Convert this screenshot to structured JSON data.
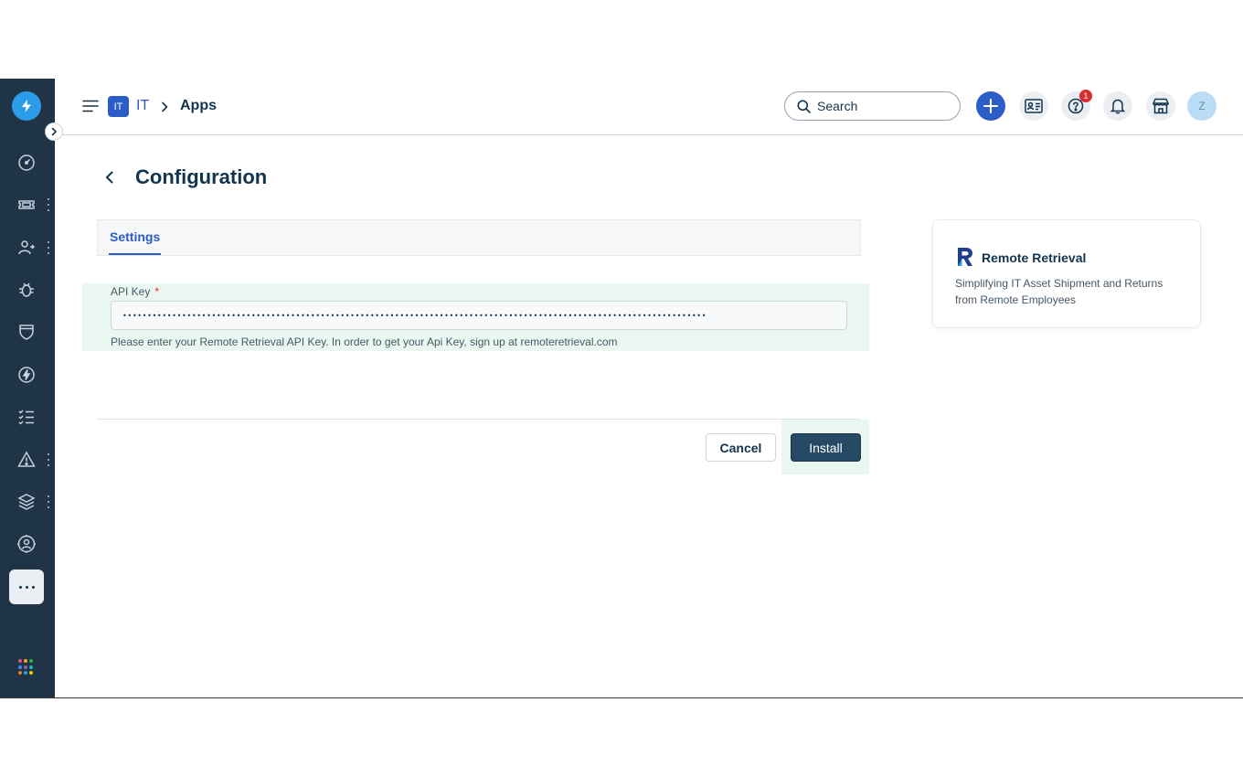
{
  "header": {
    "workspace_badge": "IT",
    "workspace_name": "IT",
    "breadcrumb_current": "Apps",
    "search_placeholder": "Search",
    "notification_count": "1",
    "avatar_initial": "Z"
  },
  "page": {
    "title": "Configuration",
    "tabs": [
      {
        "label": "Settings",
        "active": true
      }
    ]
  },
  "form": {
    "api_key": {
      "label": "API Key",
      "required_marker": "*",
      "value": "••••••••••••••••••••••••••••••••••••••••••••••••••••••••••••••••••••••••••••••••••••••••••••••••••••••••••••••••••••••",
      "hint": "Please enter your Remote Retrieval API Key. In order to get your Api Key, sign up at remoteretrieval.com"
    },
    "cancel_label": "Cancel",
    "install_label": "Install"
  },
  "app_card": {
    "name": "Remote Retrieval",
    "description": "Simplifying IT Asset Shipment and Returns from Remote Employees"
  },
  "sidebar": {
    "items": [
      "dashboard-icon",
      "tickets-icon",
      "contacts-icon",
      "bug-icon",
      "shield-icon",
      "bolt-icon",
      "checklist-icon",
      "alert-icon",
      "layers-icon",
      "support-icon",
      "more-icon",
      "apps-grid-icon"
    ]
  },
  "colors": {
    "sidebar_bg": "#1f3446",
    "accent": "#2c5cc5",
    "primary_button": "#264966",
    "highlight": "#e9f7f0",
    "required": "#d72d30"
  }
}
